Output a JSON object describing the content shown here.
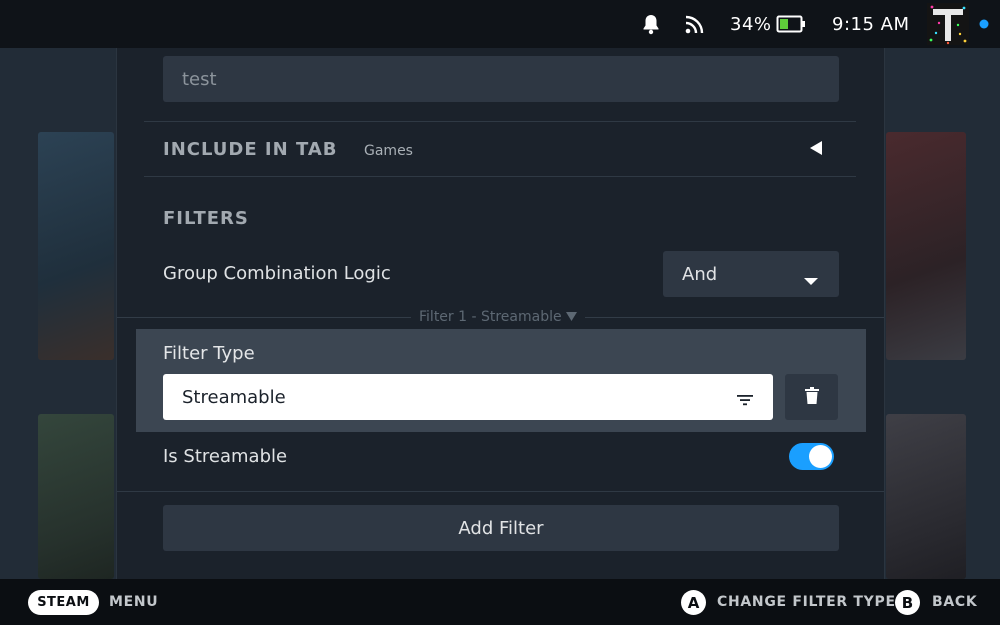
{
  "status_bar": {
    "battery_percent": "34%",
    "time": "9:15 AM",
    "icons": [
      "bell-icon",
      "wifi-icon",
      "battery-icon",
      "avatar",
      "notification-dot"
    ]
  },
  "collection_editor": {
    "name_value": "test",
    "include_in_tab": {
      "label": "INCLUDE IN TAB",
      "value": "Games"
    },
    "filters_label": "FILTERS",
    "group_logic": {
      "label": "Group Combination Logic",
      "value": "And"
    },
    "filter_group_header": "Filter 1 - Streamable",
    "filter_type": {
      "label": "Filter Type",
      "value": "Streamable"
    },
    "is_streamable": {
      "label": "Is Streamable",
      "enabled": true
    },
    "add_filter_label": "Add Filter"
  },
  "bottom_bar": {
    "steam_label": "STEAM",
    "menu_label": "MENU",
    "a_glyph": "A",
    "a_action": "CHANGE FILTER TYPE",
    "b_glyph": "B",
    "b_action": "BACK"
  },
  "colors": {
    "accent": "#1a9fff",
    "panel_bg": "#1b222b",
    "field_bg": "#2e3743",
    "highlight_bg": "#3c4652"
  }
}
